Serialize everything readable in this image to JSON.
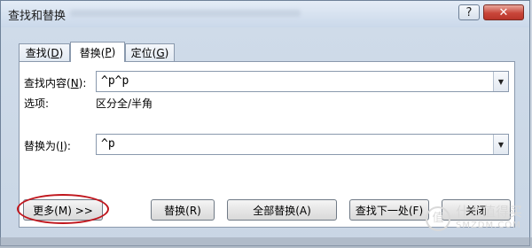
{
  "window": {
    "title": "查找和替换",
    "help_label": "?",
    "close_label": "✕"
  },
  "tabs": [
    {
      "label": "查找(",
      "key": "D",
      "suffix": ")"
    },
    {
      "label": "替换(",
      "key": "P",
      "suffix": ")"
    },
    {
      "label": "定位(",
      "key": "G",
      "suffix": ")"
    }
  ],
  "active_tab": "替换(P)",
  "find": {
    "label": "查找内容(",
    "key": "N",
    "suffix": "):",
    "value": "^p^p"
  },
  "options": {
    "label": "选项:",
    "value": "区分全/半角"
  },
  "replace": {
    "label": "替换为(",
    "key": "I",
    "suffix": "):",
    "value": "^p"
  },
  "buttons": {
    "more": "更多(M) >>",
    "replace": "替换(R)",
    "replace_all": "全部替换(A)",
    "find_next": "查找下一处(F)",
    "close": "关闭"
  },
  "watermark": {
    "text": "什么值得买",
    "sub": "SMZDM.COM",
    "icon": "值"
  },
  "colors": {
    "highlight": "#c0161d",
    "close_button": "#c9463a"
  }
}
